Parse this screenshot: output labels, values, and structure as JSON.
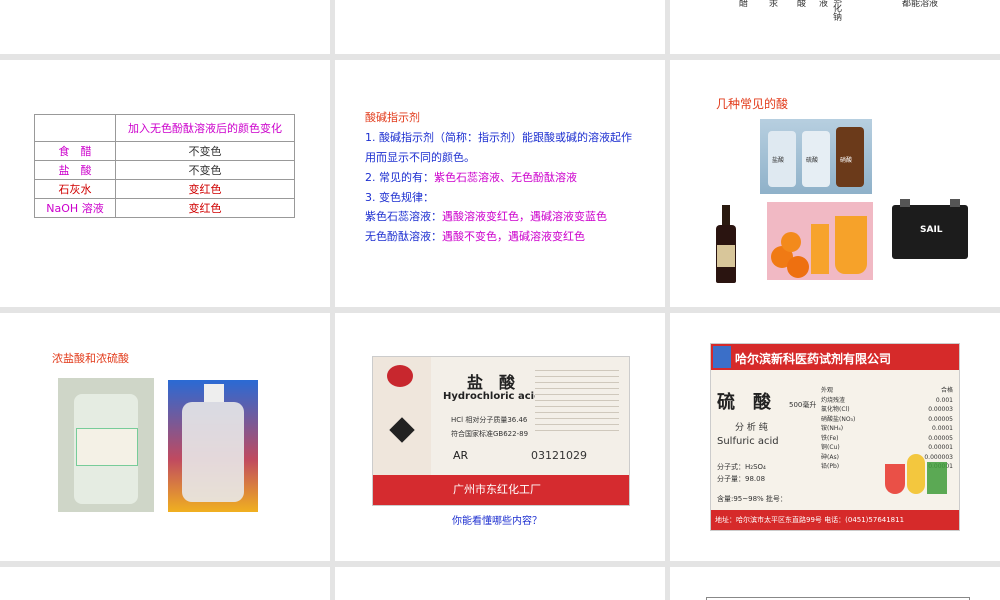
{
  "slide_top_right": {
    "vertical_words": [
      "醋",
      "盐酸",
      "溶酸",
      "液溶",
      "化",
      "钠"
    ],
    "right_text": "都能溶液"
  },
  "table_slide": {
    "header": "加入无色酚酞溶液后的颜色变化",
    "rows": [
      {
        "name": "食　醋",
        "result": "不变色"
      },
      {
        "name": "盐　酸",
        "result": "不变色"
      },
      {
        "name": "石灰水",
        "result": "变红色"
      },
      {
        "name": "NaOH 溶液",
        "result": "变红色"
      }
    ]
  },
  "indicator_slide": {
    "title": "酸碱指示剂",
    "line1a": "1. 酸碱指示剂（简称：指示剂）能跟酸或碱的溶液起作",
    "line1b": "用而显示不同的颜色。",
    "line2_prefix": "2. 常见的有：",
    "line2_value": "紫色石蕊溶液、无色酚酞溶液",
    "line3": "3. 变色规律：",
    "line4_prefix": "紫色石蕊溶液：",
    "line4_value": "遇酸溶液变红色，遇碱溶液变蓝色",
    "line5_prefix": "无色酚酞溶液：",
    "line5_value": "遇酸不变色，遇碱溶液变红色"
  },
  "acids_slide": {
    "title": "几种常见的酸",
    "bottle_labels": [
      "盐酸",
      "硫酸",
      "硝酸"
    ],
    "battery_brand": "SAIL"
  },
  "conc_slide": {
    "title": "浓盐酸和浓硫酸"
  },
  "hcl_slide": {
    "name_cn": "盐　酸",
    "name_en": "Hydrochloric acid",
    "formula_line": "HCl  相对分子质量36.46",
    "standard_line": "符合国家标准GB622-89",
    "grade": "AR",
    "batch": "03121029",
    "factory": "广州市东红化工厂",
    "question": "你能看懂哪些内容？"
  },
  "h2so4_slide": {
    "company": "哈尔滨新科医药试剂有限公司",
    "name_cn": "硫　酸",
    "volume": "500毫升",
    "grade": "分 析 纯",
    "name_en": "Sulfuric acid",
    "formula": "分子式：H₂SO₄",
    "mass": "分子量：98.08",
    "content": "含量:95~98%  批号：",
    "address": "地址：哈尔滨市太平区东直路99号    电话：(0451)57641811",
    "spec_labels": [
      "外观",
      "灼烧残渣",
      "氯化物(Cl)",
      "硝酸盐(NO₃)",
      "铵(NH₄)",
      "铁(Fe)",
      "铜(Cu)",
      "砷(As)",
      "铅(Pb)"
    ],
    "spec_values": [
      "合格",
      "0.001",
      "0.00003",
      "0.00005",
      "0.0001",
      "0.00005",
      "0.00001",
      "0.000003",
      "0.00001"
    ]
  }
}
